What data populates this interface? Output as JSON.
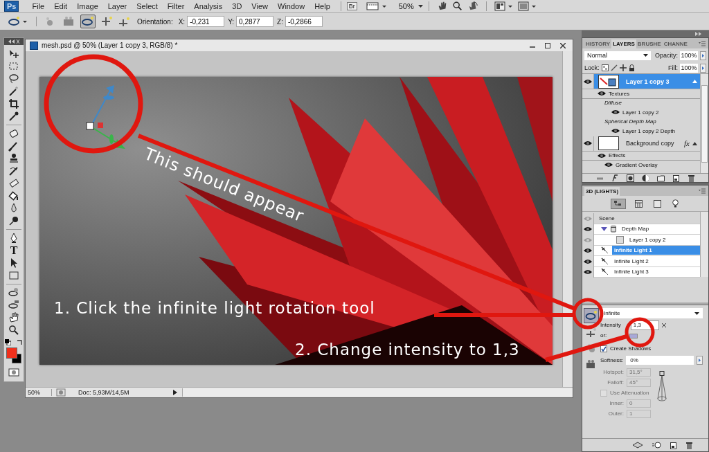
{
  "menu_bar": {
    "logo": "Ps",
    "items": [
      "File",
      "Edit",
      "Image",
      "Layer",
      "Select",
      "Filter",
      "Analysis",
      "3D",
      "View",
      "Window",
      "Help"
    ],
    "bridge": "Br",
    "zoom": "50%"
  },
  "options_bar": {
    "label": "Orientation:",
    "fields": [
      {
        "label": "X:",
        "value": "-0,231"
      },
      {
        "label": "Y:",
        "value": "0,2877"
      },
      {
        "label": "Z:",
        "value": "-0,2866"
      }
    ]
  },
  "toolbox": {
    "type_tool": "T",
    "swatches": [
      {
        "color": "#f0301c"
      },
      {
        "color": "#000000"
      }
    ]
  },
  "document": {
    "title": "mesh.psd @ 50% (Layer 1 copy 3, RGB/8) *",
    "zoom": "50%",
    "doc_info": "Doc: 5,93M/14,5M"
  },
  "annotations": [
    {
      "kind": "rotated",
      "text": "This should appear"
    },
    {
      "kind": "step",
      "text": "1. Click the infinite light rotation tool"
    },
    {
      "kind": "step",
      "text": "2. Change intensity to 1,3"
    }
  ],
  "layers_panel": {
    "tabs": [
      {
        "label": "HISTORY",
        "selected": false
      },
      {
        "label": "LAYERS",
        "selected": true
      },
      {
        "label": "BRUSHE",
        "selected": false
      },
      {
        "label": "CHANNE",
        "selected": false
      }
    ],
    "blend_mode": "Normal",
    "opacity_label": "Opacity:",
    "opacity": "100%",
    "lock_label": "Lock:",
    "fill_label": "Fill:",
    "fill": "100%",
    "layers": [
      {
        "kind": "mesh",
        "name": "Layer 1 copy 3",
        "selected": true,
        "children": [
          {
            "kind": "group",
            "name": "Textures",
            "children": [
              {
                "kind": "label",
                "name": "Diffuse",
                "children": [
                  {
                    "kind": "item",
                    "name": "Layer 1 copy 2"
                  }
                ]
              },
              {
                "kind": "label",
                "name": "Spherical Depth Map",
                "children": [
                  {
                    "kind": "item",
                    "name": "Layer 1 copy 2 Depth"
                  }
                ]
              }
            ]
          }
        ]
      },
      {
        "kind": "layer",
        "name": "Background copy",
        "selected": false,
        "badge": "fx",
        "children": [
          {
            "kind": "group",
            "name": "Effects",
            "children": [
              {
                "kind": "item",
                "name": "Gradient Overlay"
              }
            ]
          }
        ]
      }
    ]
  },
  "lights_panel": {
    "title": "3D (LIGHTS)",
    "items": [
      {
        "kind": "scene",
        "name": "Scene",
        "visible": false,
        "selected": false
      },
      {
        "kind": "depth_map",
        "name": "Depth Map",
        "visible": true,
        "selected": false,
        "expanded": true,
        "children": [
          {
            "kind": "texture",
            "name": "Layer 1 copy 2",
            "visible": false,
            "selected": false
          }
        ]
      },
      {
        "kind": "light",
        "name": "Infinite Light 1",
        "visible": true,
        "selected": true
      },
      {
        "kind": "light",
        "name": "Infinite Light 2",
        "visible": true,
        "selected": false
      },
      {
        "kind": "light",
        "name": "Infinite Light 3",
        "visible": true,
        "selected": false
      }
    ],
    "light_type": "Infinite",
    "intensity_label": "Intensity",
    "intensity": "1,3",
    "color_label": "or:",
    "create_shadows_label": "Create Shadows",
    "create_shadows": true,
    "softness_label": "Softness:",
    "softness": "0%",
    "spot": [
      {
        "label": "Hotspot:",
        "value": "31,5°",
        "disabled": true
      },
      {
        "label": "Falloff:",
        "value": "45°",
        "disabled": true
      }
    ],
    "attenuation_label": "Use Attenuation",
    "attenuation": false,
    "attenuation_disabled": true,
    "attenuation_fields": [
      {
        "label": "Inner:",
        "value": "0",
        "disabled": true
      },
      {
        "label": "Outer:",
        "value": "1",
        "disabled": true
      }
    ]
  }
}
